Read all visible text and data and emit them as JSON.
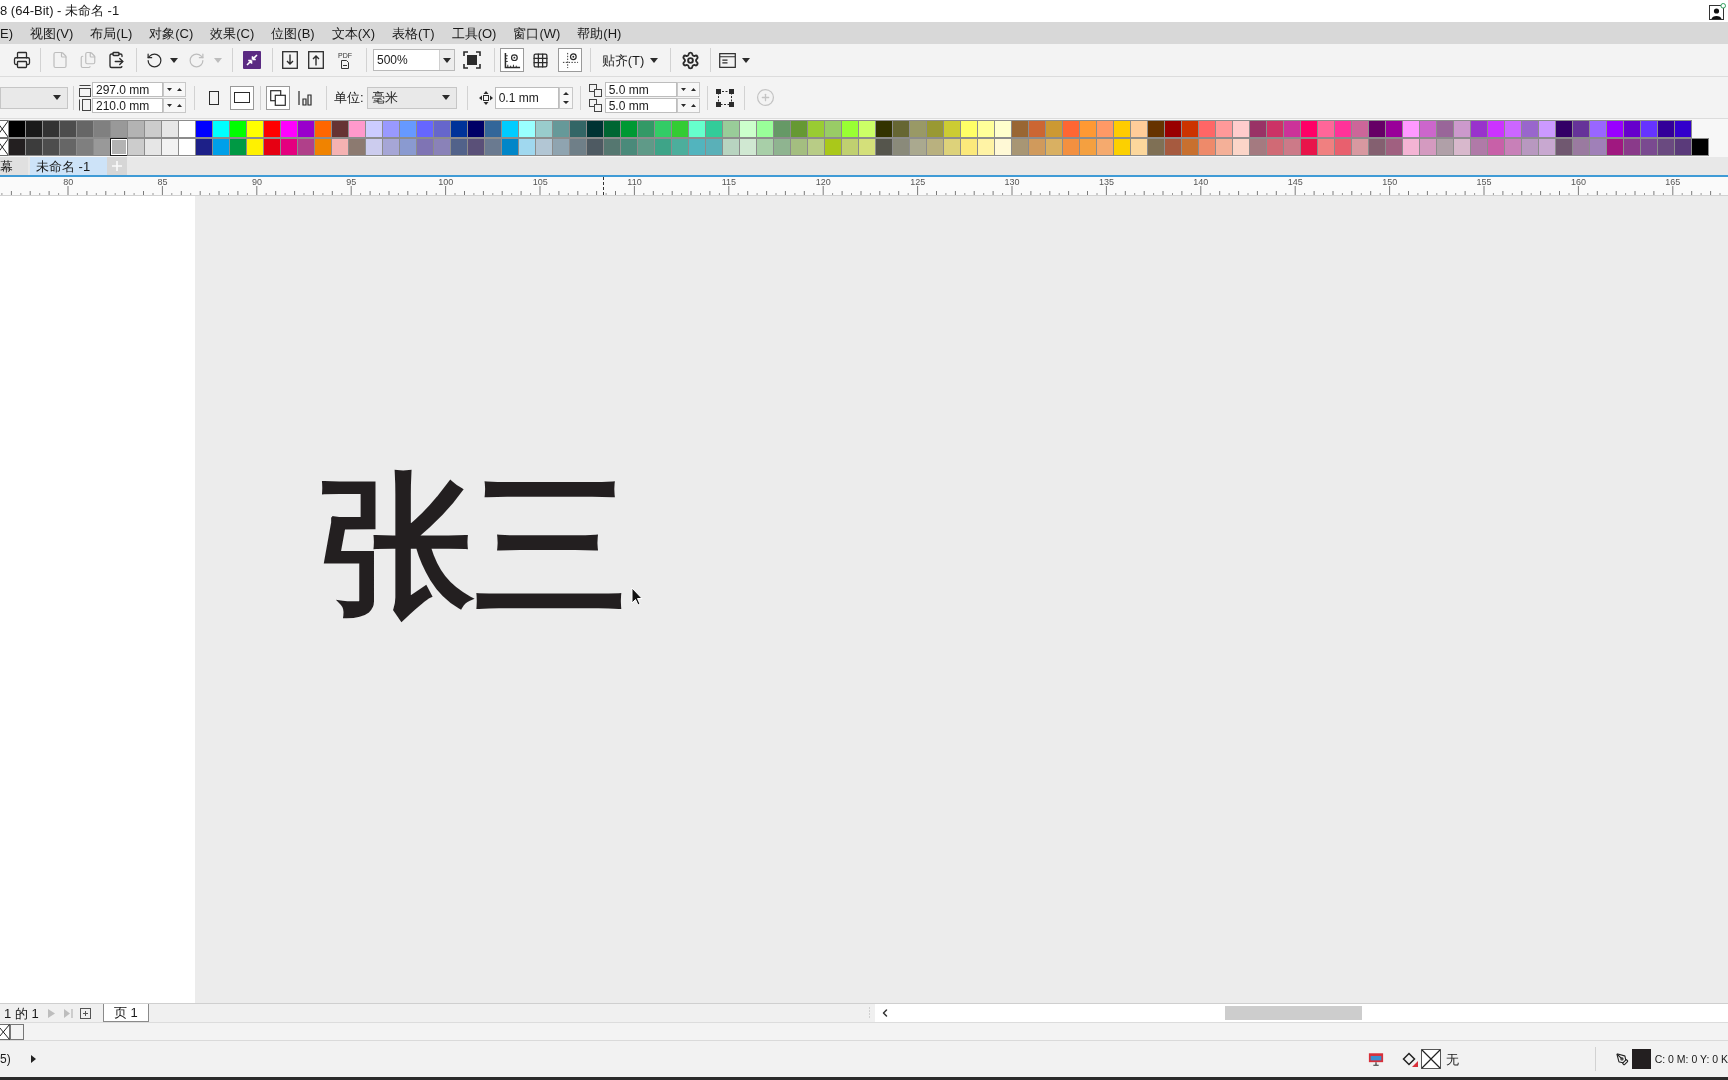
{
  "window": {
    "title": "8 (64-Bit) - 未命名 -1"
  },
  "menu": [
    "E)",
    "视图(V)",
    "布局(L)",
    "对象(C)",
    "效果(C)",
    "位图(B)",
    "文本(X)",
    "表格(T)",
    "工具(O)",
    "窗口(W)",
    "帮助(H)"
  ],
  "toolbar": {
    "groups": [
      [
        {
          "kind": "print"
        }
      ],
      [
        {
          "kind": "cut",
          "disabled": true
        },
        {
          "kind": "copy",
          "disabled": true
        },
        {
          "kind": "paste",
          "disabled": false
        }
      ],
      [
        {
          "kind": "undo",
          "disabled": false
        },
        {
          "kind": "redo",
          "disabled": true
        }
      ],
      [
        {
          "kind": "launch"
        }
      ],
      [
        {
          "kind": "import"
        },
        {
          "kind": "export"
        },
        {
          "kind": "pdf",
          "label": "PDF"
        }
      ],
      [
        {
          "kind": "zoom",
          "value": "500%"
        },
        {
          "kind": "fullscreen"
        }
      ],
      [
        {
          "kind": "rulers",
          "on": true
        },
        {
          "kind": "grid",
          "on": false
        },
        {
          "kind": "guides",
          "on": true
        }
      ],
      [
        {
          "kind": "snap",
          "label": "贴齐(T)"
        }
      ],
      [
        {
          "kind": "settings"
        }
      ],
      [
        {
          "kind": "layout"
        }
      ]
    ]
  },
  "property_bar": {
    "page_width": "297.0 mm",
    "page_height": "210.0 mm",
    "orientation": [
      {
        "kind": "portrait",
        "selected": false
      },
      {
        "kind": "landscape",
        "selected": true
      }
    ],
    "page_scope": [
      {
        "kind": "all-pages",
        "selected": true
      },
      {
        "kind": "current-page",
        "selected": false
      }
    ],
    "units_label": "单位:",
    "units": "毫米",
    "nudge": "0.1 mm",
    "duplicate_x": "5.0 mm",
    "duplicate_y": "5.0 mm"
  },
  "palette": {
    "rows": [
      {
        "swatches": [
          {
            "color": "#000000",
            "selected": false
          },
          {
            "color": "#1a1a1a",
            "selected": false
          },
          {
            "color": "#333333",
            "selected": false
          },
          {
            "color": "#4d4d4d",
            "selected": false
          },
          {
            "color": "#666666",
            "selected": false
          },
          {
            "color": "#808080",
            "selected": false
          },
          {
            "color": "#999999",
            "selected": false
          },
          {
            "color": "#b3b3b3",
            "selected": false
          },
          {
            "color": "#cccccc",
            "selected": false
          },
          {
            "color": "#e6e6e6",
            "selected": false
          },
          {
            "color": "#ffffff",
            "selected": false
          },
          {
            "color": "#0000ff",
            "selected": false
          },
          {
            "color": "#00ffff",
            "selected": false
          },
          {
            "color": "#00ff00",
            "selected": false
          },
          {
            "color": "#ffff00",
            "selected": false
          },
          {
            "color": "#ff0000",
            "selected": false
          },
          {
            "color": "#ff00ff",
            "selected": false
          },
          {
            "color": "#9900cc",
            "selected": false
          },
          {
            "color": "#ff6600",
            "selected": false
          },
          {
            "color": "#663333",
            "selected": false
          },
          {
            "color": "#ff99cc",
            "selected": false
          },
          {
            "color": "#ccccff",
            "selected": false
          },
          {
            "color": "#9999ff",
            "selected": false
          },
          {
            "color": "#6699ff",
            "selected": false
          },
          {
            "color": "#6666ff",
            "selected": false
          },
          {
            "color": "#6666cc",
            "selected": false
          },
          {
            "color": "#003399",
            "selected": false
          },
          {
            "color": "#000066",
            "selected": false
          },
          {
            "color": "#336699",
            "selected": false
          },
          {
            "color": "#00ccff",
            "selected": false
          },
          {
            "color": "#99ffff",
            "selected": false
          },
          {
            "color": "#99cccc",
            "selected": false
          },
          {
            "color": "#669999",
            "selected": false
          },
          {
            "color": "#336666",
            "selected": false
          },
          {
            "color": "#003333",
            "selected": false
          },
          {
            "color": "#006633",
            "selected": false
          },
          {
            "color": "#009933",
            "selected": false
          },
          {
            "color": "#339966",
            "selected": false
          },
          {
            "color": "#33cc66",
            "selected": false
          },
          {
            "color": "#33cc33",
            "selected": false
          },
          {
            "color": "#66ffcc",
            "selected": false
          },
          {
            "color": "#33cc99",
            "selected": false
          },
          {
            "color": "#99cc99",
            "selected": false
          },
          {
            "color": "#ccffcc",
            "selected": false
          },
          {
            "color": "#99ff99",
            "selected": false
          },
          {
            "color": "#669966",
            "selected": false
          },
          {
            "color": "#669933",
            "selected": false
          },
          {
            "color": "#99cc33",
            "selected": false
          },
          {
            "color": "#99cc66",
            "selected": false
          },
          {
            "color": "#99ff33",
            "selected": false
          },
          {
            "color": "#ccff66",
            "selected": false
          },
          {
            "color": "#333300",
            "selected": false
          },
          {
            "color": "#666633",
            "selected": false
          },
          {
            "color": "#999966",
            "selected": false
          },
          {
            "color": "#999933",
            "selected": false
          },
          {
            "color": "#cccc33",
            "selected": false
          },
          {
            "color": "#ffff66",
            "selected": false
          },
          {
            "color": "#ffff99",
            "selected": false
          },
          {
            "color": "#ffffcc",
            "selected": false
          },
          {
            "color": "#996633",
            "selected": false
          },
          {
            "color": "#cc6633",
            "selected": false
          },
          {
            "color": "#cc9933",
            "selected": false
          },
          {
            "color": "#ff6633",
            "selected": false
          },
          {
            "color": "#ff9933",
            "selected": false
          },
          {
            "color": "#ff9966",
            "selected": false
          },
          {
            "color": "#ffcc00",
            "selected": false
          },
          {
            "color": "#ffcc99",
            "selected": false
          },
          {
            "color": "#663300",
            "selected": false
          },
          {
            "color": "#990000",
            "selected": false
          },
          {
            "color": "#cc3300",
            "selected": false
          },
          {
            "color": "#ff6666",
            "selected": false
          },
          {
            "color": "#ff9999",
            "selected": false
          },
          {
            "color": "#ffcccc",
            "selected": false
          },
          {
            "color": "#993366",
            "selected": false
          },
          {
            "color": "#cc3366",
            "selected": false
          },
          {
            "color": "#cc3399",
            "selected": false
          },
          {
            "color": "#ff0066",
            "selected": false
          },
          {
            "color": "#ff6699",
            "selected": false
          },
          {
            "color": "#ff3399",
            "selected": false
          },
          {
            "color": "#cc6699",
            "selected": false
          },
          {
            "color": "#660066",
            "selected": false
          },
          {
            "color": "#990099",
            "selected": false
          },
          {
            "color": "#ff99ff",
            "selected": false
          },
          {
            "color": "#cc66cc",
            "selected": false
          },
          {
            "color": "#996699",
            "selected": false
          },
          {
            "color": "#cc99cc",
            "selected": false
          },
          {
            "color": "#9933cc",
            "selected": false
          },
          {
            "color": "#cc33ff",
            "selected": false
          },
          {
            "color": "#cc66ff",
            "selected": false
          },
          {
            "color": "#9966cc",
            "selected": false
          },
          {
            "color": "#cc99ff",
            "selected": false
          },
          {
            "color": "#330066",
            "selected": false
          },
          {
            "color": "#663399",
            "selected": false
          },
          {
            "color": "#9966ff",
            "selected": false
          },
          {
            "color": "#9900ff",
            "selected": false
          },
          {
            "color": "#6600cc",
            "selected": false
          },
          {
            "color": "#6633ff",
            "selected": false
          },
          {
            "color": "#330099",
            "selected": false
          },
          {
            "color": "#3300cc",
            "selected": false
          }
        ]
      },
      {
        "swatches": [
          {
            "color": "#231f20",
            "selected": false
          },
          {
            "color": "#3c3c3c",
            "selected": false
          },
          {
            "color": "#4d4d4d",
            "selected": false
          },
          {
            "color": "#666666",
            "selected": false
          },
          {
            "color": "#7f7f7f",
            "selected": false
          },
          {
            "color": "#999999",
            "selected": false
          },
          {
            "color": "#b3b3b3",
            "selected": true
          },
          {
            "color": "#cccccc",
            "selected": false
          },
          {
            "color": "#e6e6e6",
            "selected": false
          },
          {
            "color": "#f2f2f2",
            "selected": false
          },
          {
            "color": "#ffffff",
            "selected": false
          },
          {
            "color": "#1d2088",
            "selected": false
          },
          {
            "color": "#00a0e9",
            "selected": false
          },
          {
            "color": "#009944",
            "selected": false
          },
          {
            "color": "#fff100",
            "selected": false
          },
          {
            "color": "#e60012",
            "selected": false
          },
          {
            "color": "#e4007f",
            "selected": false
          },
          {
            "color": "#b0408a",
            "selected": false
          },
          {
            "color": "#f08300",
            "selected": false
          },
          {
            "color": "#f5b2b2",
            "selected": false
          },
          {
            "color": "#8c7a70",
            "selected": false
          },
          {
            "color": "#ccccee",
            "selected": false
          },
          {
            "color": "#a6a6d6",
            "selected": false
          },
          {
            "color": "#8a9ad0",
            "selected": false
          },
          {
            "color": "#7f74b4",
            "selected": false
          },
          {
            "color": "#8a82b8",
            "selected": false
          },
          {
            "color": "#52628a",
            "selected": false
          },
          {
            "color": "#5a5078",
            "selected": false
          },
          {
            "color": "#6a7a90",
            "selected": false
          },
          {
            "color": "#0086c8",
            "selected": false
          },
          {
            "color": "#a0d8ef",
            "selected": false
          },
          {
            "color": "#b2c6d4",
            "selected": false
          },
          {
            "color": "#8fa4b0",
            "selected": false
          },
          {
            "color": "#6f7f88",
            "selected": false
          },
          {
            "color": "#4e5a62",
            "selected": false
          },
          {
            "color": "#557770",
            "selected": false
          },
          {
            "color": "#4a8a7a",
            "selected": false
          },
          {
            "color": "#5f9a88",
            "selected": false
          },
          {
            "color": "#3ea488",
            "selected": false
          },
          {
            "color": "#4cae9c",
            "selected": false
          },
          {
            "color": "#52b4be",
            "selected": false
          },
          {
            "color": "#5ab0b8",
            "selected": false
          },
          {
            "color": "#b8d4c0",
            "selected": false
          },
          {
            "color": "#d0e8d2",
            "selected": false
          },
          {
            "color": "#a8cfa8",
            "selected": false
          },
          {
            "color": "#8fb490",
            "selected": false
          },
          {
            "color": "#a4be80",
            "selected": false
          },
          {
            "color": "#b8cc86",
            "selected": false
          },
          {
            "color": "#aac81a",
            "selected": false
          },
          {
            "color": "#c0d070",
            "selected": false
          },
          {
            "color": "#d4e07a",
            "selected": false
          },
          {
            "color": "#55554c",
            "selected": false
          },
          {
            "color": "#8a8a7a",
            "selected": false
          },
          {
            "color": "#aaa98f",
            "selected": false
          },
          {
            "color": "#b9b17f",
            "selected": false
          },
          {
            "color": "#ddd27a",
            "selected": false
          },
          {
            "color": "#fbe97b",
            "selected": false
          },
          {
            "color": "#fff3a5",
            "selected": false
          },
          {
            "color": "#fff9d6",
            "selected": false
          },
          {
            "color": "#a89674",
            "selected": false
          },
          {
            "color": "#d09a5c",
            "selected": false
          },
          {
            "color": "#d9b062",
            "selected": false
          },
          {
            "color": "#f39040",
            "selected": false
          },
          {
            "color": "#f4a040",
            "selected": false
          },
          {
            "color": "#f5aa6e",
            "selected": false
          },
          {
            "color": "#fcd000",
            "selected": false
          },
          {
            "color": "#fcd79c",
            "selected": false
          },
          {
            "color": "#7f7055",
            "selected": false
          },
          {
            "color": "#a65a3f",
            "selected": false
          },
          {
            "color": "#c8702f",
            "selected": false
          },
          {
            "color": "#ee8a6a",
            "selected": false
          },
          {
            "color": "#f4b098",
            "selected": false
          },
          {
            "color": "#fbd5c8",
            "selected": false
          },
          {
            "color": "#a47a80",
            "selected": false
          },
          {
            "color": "#d06a75",
            "selected": false
          },
          {
            "color": "#cc7a88",
            "selected": false
          },
          {
            "color": "#e8144a",
            "selected": false
          },
          {
            "color": "#f08080",
            "selected": false
          },
          {
            "color": "#e8606e",
            "selected": false
          },
          {
            "color": "#d898a0",
            "selected": false
          },
          {
            "color": "#846070",
            "selected": false
          },
          {
            "color": "#a06080",
            "selected": false
          },
          {
            "color": "#f4b4d4",
            "selected": false
          },
          {
            "color": "#d49ac0",
            "selected": false
          },
          {
            "color": "#b0a0a8",
            "selected": false
          },
          {
            "color": "#d8b8cc",
            "selected": false
          },
          {
            "color": "#b07aa8",
            "selected": false
          },
          {
            "color": "#c860a8",
            "selected": false
          },
          {
            "color": "#c880b8",
            "selected": false
          },
          {
            "color": "#b898c0",
            "selected": false
          },
          {
            "color": "#c8a8d0",
            "selected": false
          },
          {
            "color": "#705870",
            "selected": false
          },
          {
            "color": "#9a7aa0",
            "selected": false
          },
          {
            "color": "#a080b8",
            "selected": false
          },
          {
            "color": "#a01880",
            "selected": false
          },
          {
            "color": "#8a3a8a",
            "selected": false
          },
          {
            "color": "#7a4a90",
            "selected": false
          },
          {
            "color": "#6a4a80",
            "selected": false
          },
          {
            "color": "#5a3a7a",
            "selected": false
          },
          {
            "color": "#000000",
            "selected": false
          }
        ]
      }
    ]
  },
  "document_tabs": [
    {
      "label": "幕",
      "selected": false
    },
    {
      "label": "未命名 -1",
      "selected": true
    }
  ],
  "ruler": {
    "labels": [
      "80",
      "85",
      "90",
      "95",
      "100",
      "105",
      "110",
      "115",
      "120",
      "125",
      "130",
      "135",
      "140",
      "145",
      "150",
      "155",
      "160",
      "165"
    ]
  },
  "canvas": {
    "text": "张三"
  },
  "page_navigation": {
    "counter": "1 的 1",
    "pages": [
      {
        "label": "页 1",
        "selected": true
      }
    ]
  },
  "status_bar": {
    "hint": "5)",
    "fill": "无",
    "outline": {
      "color": "#231f20",
      "values": "C: 0 M: 0 Y: 0 K"
    }
  }
}
